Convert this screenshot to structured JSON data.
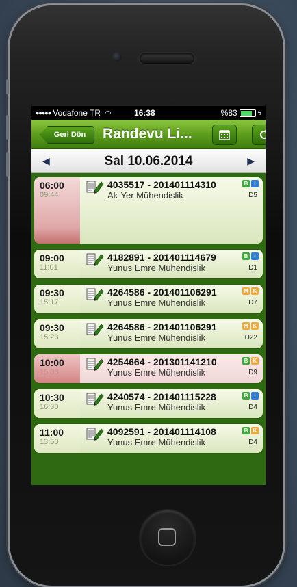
{
  "status_bar": {
    "carrier": "Vodafone TR",
    "time": "16:38",
    "battery": "%83"
  },
  "nav": {
    "back_label": "Geri Dön",
    "title": "Randevu Li...",
    "calendar_icon": "calendar-icon",
    "refresh_icon": "refresh-icon"
  },
  "date_bar": {
    "date": "Sal 10.06.2014"
  },
  "badge_colors": {
    "B": "#3dab3a",
    "I": "#2c7fe0",
    "M": "#f0a93a",
    "K": "#f0a93a"
  },
  "appointments": [
    {
      "start": "06:00",
      "end": "09:44",
      "title": "4035517 - 201401114310",
      "company": "Ak-Yer Mühendislik",
      "badges": [
        "B",
        "I"
      ],
      "code": "D5",
      "style": "big"
    },
    {
      "start": "09:00",
      "end": "11:01",
      "title": "4182891 - 201401114679",
      "company": "Yunus Emre Mühendislik",
      "badges": [
        "B",
        "I"
      ],
      "code": "D1",
      "style": "green"
    },
    {
      "start": "09:30",
      "end": "15:17",
      "title": "4264586 - 201401106291",
      "company": "Yunus Emre Mühendislik",
      "badges": [
        "M",
        "K"
      ],
      "code": "D7",
      "style": "green"
    },
    {
      "start": "09:30",
      "end": "15:23",
      "title": "4264586 - 201401106291",
      "company": "Yunus Emre Mühendislik",
      "badges": [
        "M",
        "K"
      ],
      "code": "D22",
      "style": "green"
    },
    {
      "start": "10:00",
      "end": "15:08",
      "title": "4254664 - 201301141210",
      "company": "Yunus Emre Mühendislik",
      "badges": [
        "B",
        "K"
      ],
      "code": "D9",
      "style": "pink"
    },
    {
      "start": "10:30",
      "end": "16:30",
      "title": "4240574 - 201401115228",
      "company": "Yunus Emre Mühendislik",
      "badges": [
        "B",
        "I"
      ],
      "code": "D4",
      "style": "green"
    },
    {
      "start": "11:00",
      "end": "13:50",
      "title": "4092591 - 201401114108",
      "company": "Yunus Emre Mühendislik",
      "badges": [
        "B",
        "K"
      ],
      "code": "D4",
      "style": "green"
    }
  ]
}
